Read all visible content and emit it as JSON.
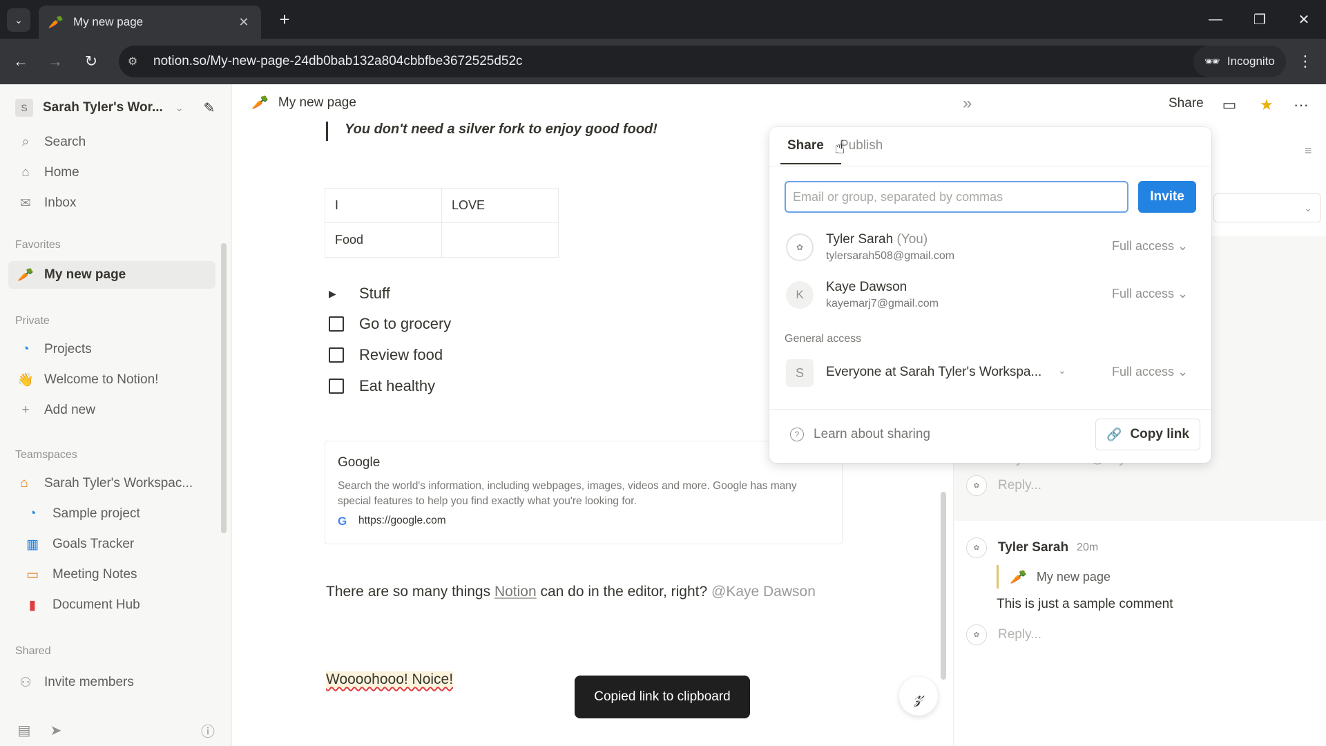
{
  "browser": {
    "tab_title": "My new page",
    "url": "notion.so/My-new-page-24db0bab132a804cbbfbe3672525d52c",
    "incognito_label": "Incognito"
  },
  "sidebar": {
    "workspace_badge": "S",
    "workspace_name": "Sarah Tyler's Wor...",
    "top_items": [
      {
        "label": "Search",
        "icon": "search-icon"
      },
      {
        "label": "Home",
        "icon": "home-icon"
      },
      {
        "label": "Inbox",
        "icon": "inbox-icon"
      }
    ],
    "favorites_heading": "Favorites",
    "favorites": [
      {
        "label": "My new page",
        "icon": "carrot-icon"
      }
    ],
    "private_heading": "Private",
    "private_items": [
      {
        "label": "Projects",
        "icon": "projects-icon"
      },
      {
        "label": "Welcome to Notion!",
        "icon": "wave-icon"
      },
      {
        "label": "Add new",
        "icon": "plus-icon"
      }
    ],
    "teamspaces_heading": "Teamspaces",
    "teamspaces": [
      {
        "label": "Sarah Tyler's Workspac...",
        "icon": "house-icon"
      },
      {
        "label": "Sample project",
        "icon": "projects-icon"
      },
      {
        "label": "Goals Tracker",
        "icon": "chart-icon"
      },
      {
        "label": "Meeting Notes",
        "icon": "calendar-icon"
      },
      {
        "label": "Document Hub",
        "icon": "document-icon"
      }
    ],
    "shared_heading": "Shared",
    "invite_label": "Invite members"
  },
  "topbar": {
    "page_title": "My new page",
    "share_label": "Share"
  },
  "page": {
    "quote": "You don't need a silver fork to enjoy good food!",
    "table": [
      [
        "I",
        "LOVE"
      ],
      [
        "Food",
        ""
      ]
    ],
    "toggle_label": "Stuff",
    "todos": [
      "Go to grocery",
      "Review food",
      "Eat healthy"
    ],
    "bookmark": {
      "title": "Google",
      "description": "Search the world's information, including webpages, images, videos and more. Google has many special features to help you find exactly what you're looking for.",
      "url": "https://google.com"
    },
    "paragraph": {
      "before": "There are so many things ",
      "link": "Notion",
      "after": " can do in the editor, right? ",
      "mention": "@Kaye Dawson"
    },
    "highlight_text": "Woooohooo! Noice!",
    "toast": "Copied link to clipboard"
  },
  "comments": {
    "partial_text": "Do you like this? @Kaye Dawson",
    "reply_placeholder": "Reply...",
    "author": "Tyler Sarah",
    "time": "20m",
    "ref_page": "My new page",
    "body": "This is just a sample comment"
  },
  "share_popup": {
    "tab_share": "Share",
    "tab_publish": "Publish",
    "input_placeholder": "Email or group, separated by commas",
    "invite_label": "Invite",
    "users": [
      {
        "name": "Tyler Sarah",
        "you": "(You)",
        "email": "tylersarah508@gmail.com",
        "access": "Full access ⌄",
        "initial": ""
      },
      {
        "name": "Kaye Dawson",
        "you": "",
        "email": "kayemarj7@gmail.com",
        "access": "Full access ⌄",
        "initial": "K"
      }
    ],
    "general_access_label": "General access",
    "general_access_initial": "S",
    "general_access_name": "Everyone at Sarah Tyler's Workspa...",
    "general_access_level": "Full access ⌄",
    "learn_label": "Learn about sharing",
    "copy_link_label": "Copy link"
  }
}
